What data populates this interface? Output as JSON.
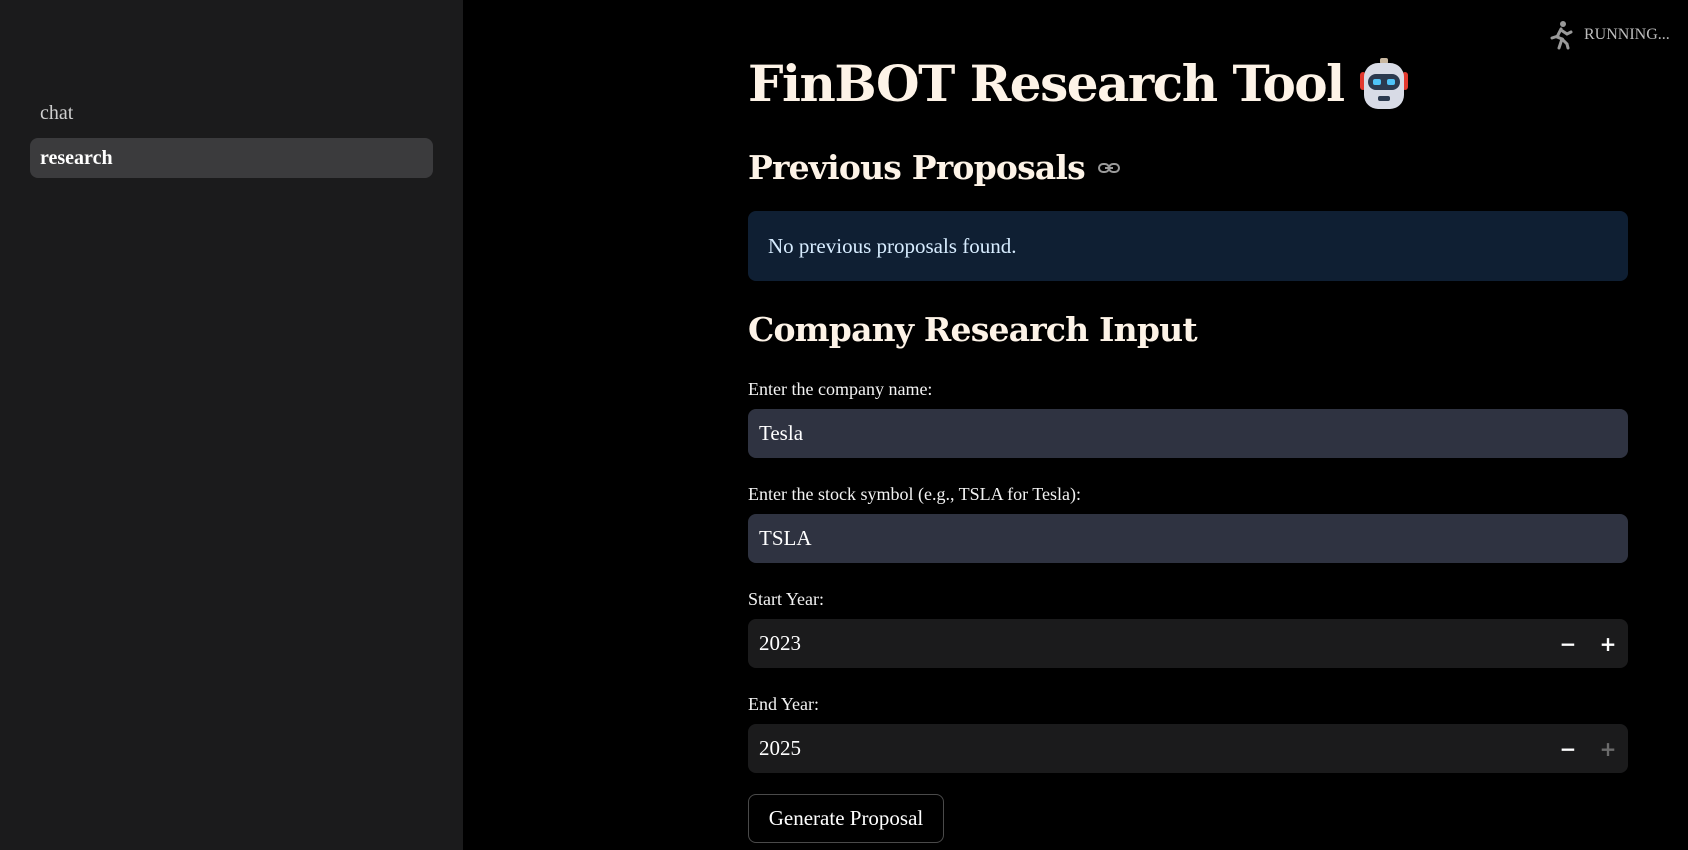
{
  "sidebar": {
    "items": [
      {
        "label": "chat"
      },
      {
        "label": "research"
      }
    ]
  },
  "status": {
    "label": "RUNNING..."
  },
  "main": {
    "title": "FinBOT Research Tool",
    "previous": {
      "heading": "Previous Proposals",
      "info": "No previous proposals found."
    },
    "input": {
      "heading": "Company Research Input",
      "company_label": "Enter the company name:",
      "company_value": "Tesla",
      "symbol_label": "Enter the stock symbol (e.g., TSLA for Tesla):",
      "symbol_value": "TSLA",
      "start_label": "Start Year:",
      "start_value": "2023",
      "end_label": "End Year:",
      "end_value": "2025",
      "minus": "−",
      "plus": "+"
    },
    "generate_button": "Generate Proposal"
  }
}
